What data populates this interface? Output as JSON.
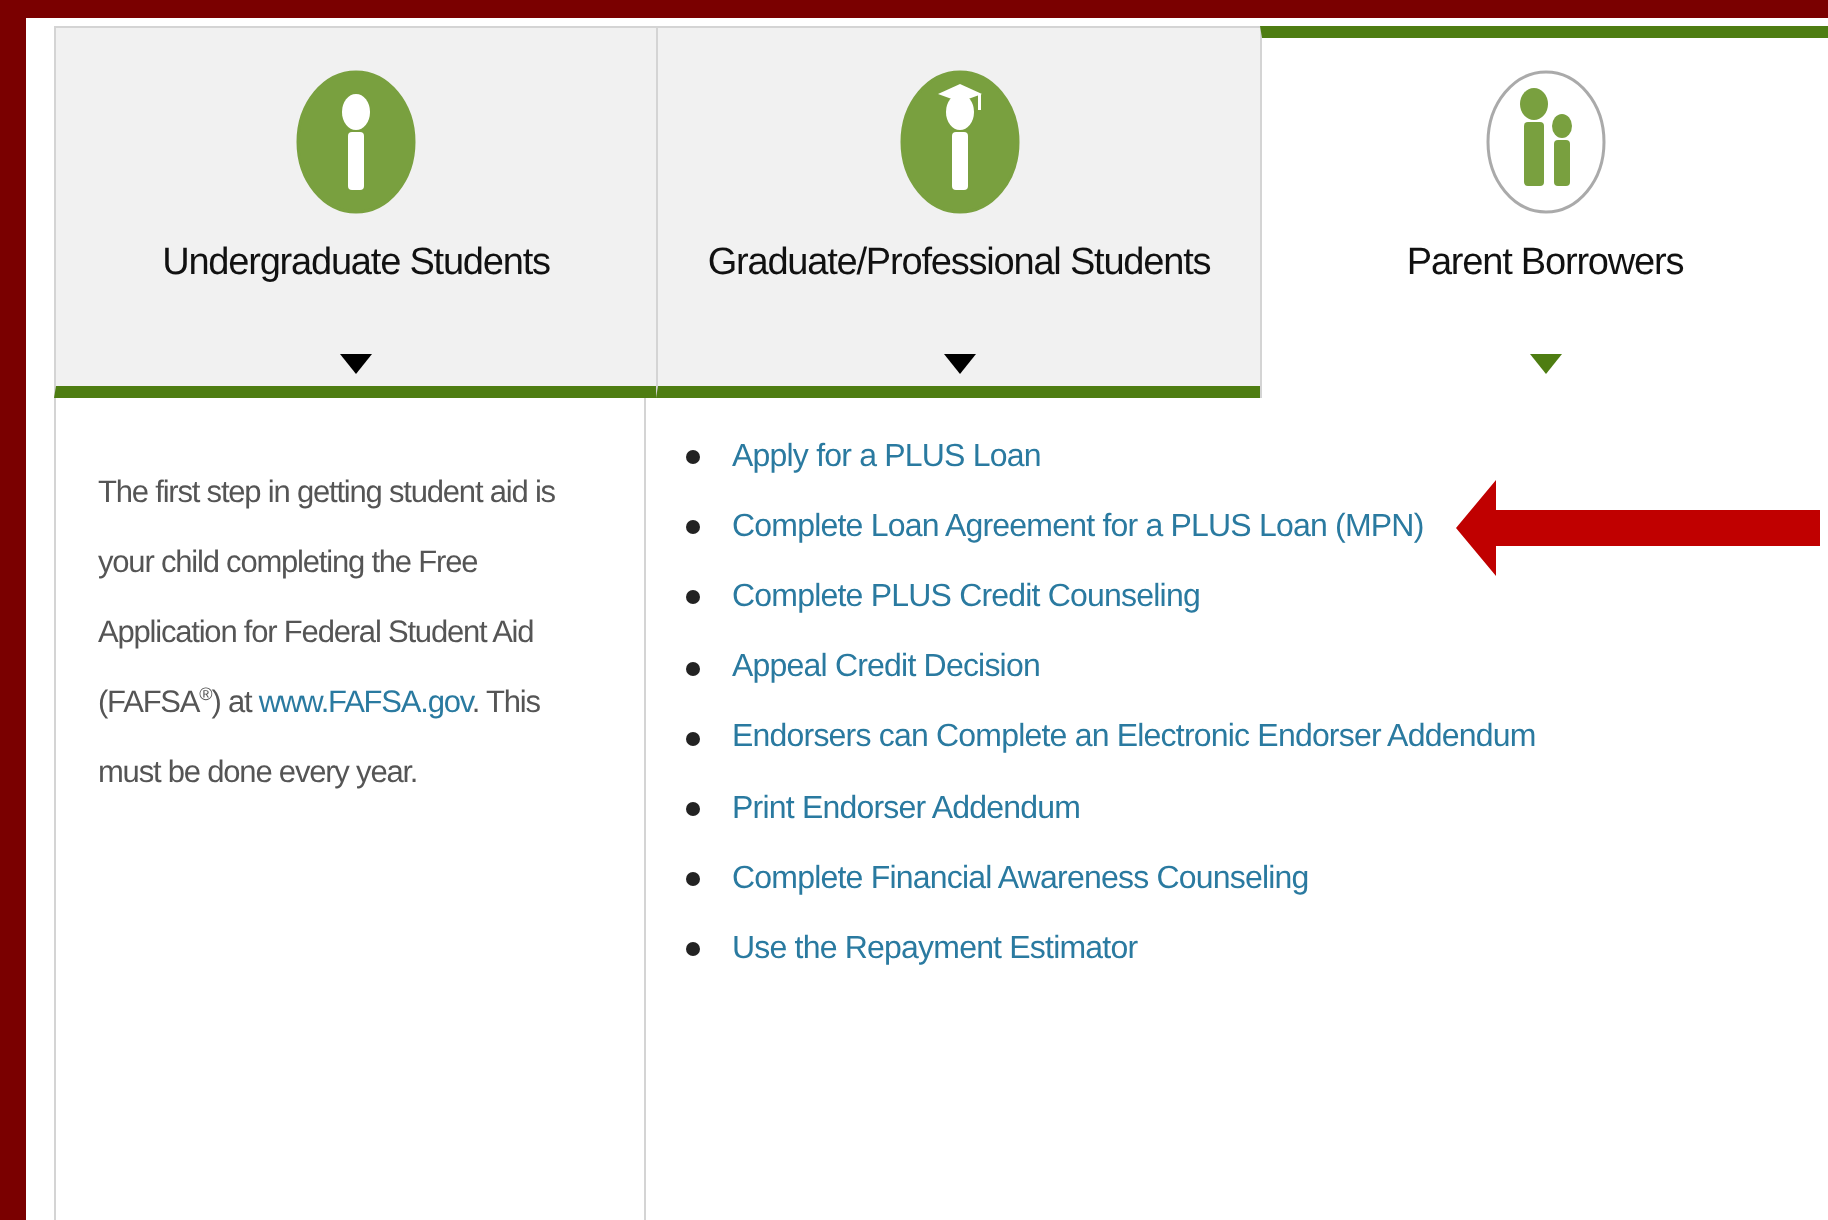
{
  "tabs": [
    {
      "label": "Undergraduate Students",
      "kind": "student",
      "selected": false
    },
    {
      "label": "Graduate/Professional Students",
      "kind": "graduate",
      "selected": false
    },
    {
      "label": "Parent Borrowers",
      "kind": "parent",
      "selected": true
    }
  ],
  "intro": {
    "before": "The first step in getting student aid is your child completing the Free Application for Federal Student Aid (FAFSA$^{®}$) at ",
    "link": "www.FAFSA.gov",
    "after": ". This must be done every year."
  },
  "links": [
    {
      "label": "Apply for a PLUS Loan",
      "highlighted": false
    },
    {
      "label": "Complete Loan Agreement for a PLUS Loan (MPN)",
      "highlighted": true
    },
    {
      "label": "Complete PLUS Credit Counseling",
      "highlighted": false
    },
    {
      "label": "Appeal Credit Decision",
      "highlighted": false
    },
    {
      "label": "Endorsers can Complete an Electronic Endorser Addendum",
      "highlighted": false
    },
    {
      "label": "Print Endorser Addendum",
      "highlighted": false
    },
    {
      "label": "Complete Financial Awareness Counseling",
      "highlighted": false
    },
    {
      "label": "Use the Repayment Estimator",
      "highlighted": false
    }
  ]
}
